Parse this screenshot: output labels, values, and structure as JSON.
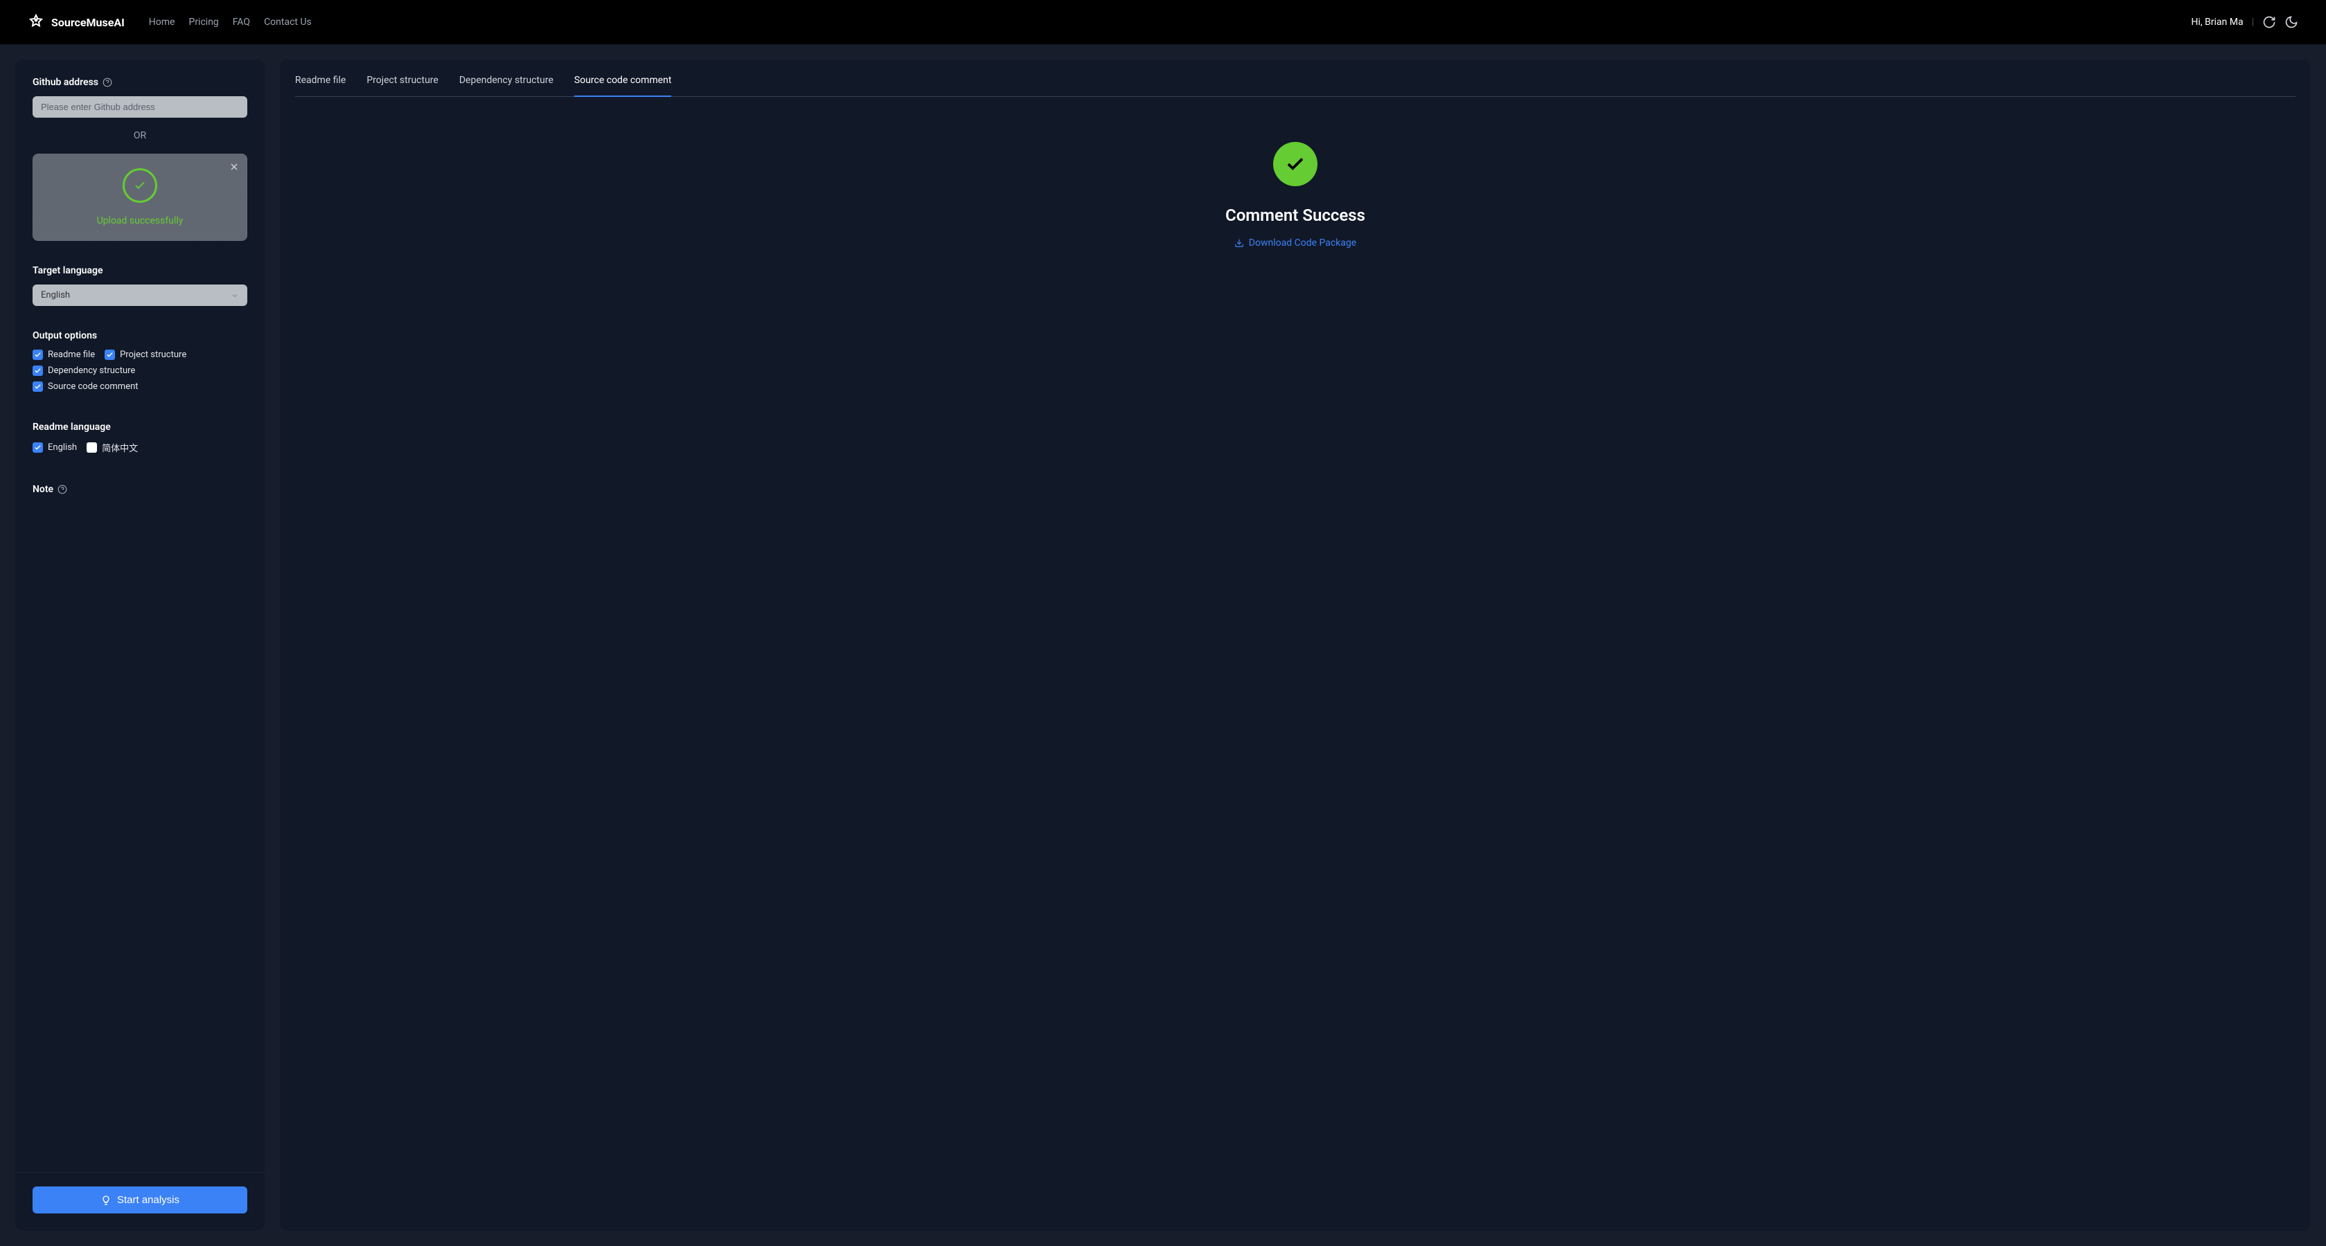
{
  "header": {
    "brand": "SourceMuseAI",
    "nav": [
      {
        "label": "Home"
      },
      {
        "label": "Pricing"
      },
      {
        "label": "FAQ"
      },
      {
        "label": "Contact Us"
      }
    ],
    "user_greeting": "Hi, Brian Ma"
  },
  "sidebar": {
    "github_label": "Github address",
    "github_placeholder": "Please enter Github address",
    "or_text": "OR",
    "upload_status": "Upload successfully",
    "target_lang_label": "Target language",
    "target_lang_value": "English",
    "output_options_label": "Output options",
    "output_options": [
      {
        "label": "Readme file",
        "checked": true
      },
      {
        "label": "Project structure",
        "checked": true
      },
      {
        "label": "Dependency structure",
        "checked": true
      },
      {
        "label": "Source code comment",
        "checked": true
      }
    ],
    "readme_lang_label": "Readme language",
    "readme_langs": [
      {
        "label": "English",
        "checked": true
      },
      {
        "label": "简体中文",
        "checked": false
      }
    ],
    "note_label": "Note",
    "start_button": "Start analysis"
  },
  "content": {
    "tabs": [
      {
        "label": "Readme file",
        "active": false
      },
      {
        "label": "Project structure",
        "active": false
      },
      {
        "label": "Dependency structure",
        "active": false
      },
      {
        "label": "Source code comment",
        "active": true
      }
    ],
    "success_title": "Comment Success",
    "download_text": "Download Code Package"
  }
}
